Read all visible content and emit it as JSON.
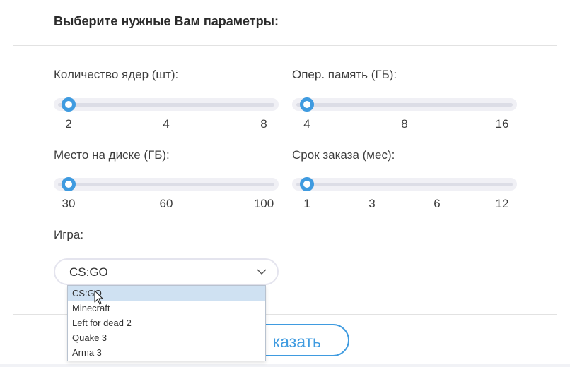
{
  "title": "Выберите нужные Вам параметры:",
  "params": {
    "cores": {
      "label": "Количество ядер (шт):",
      "ticks": [
        "2",
        "4",
        "8"
      ],
      "value": 2
    },
    "ram": {
      "label": "Опер. память (ГБ):",
      "ticks": [
        "4",
        "8",
        "16"
      ],
      "value": 4
    },
    "disk": {
      "label": "Место на диске (ГБ):",
      "ticks": [
        "30",
        "60",
        "100"
      ],
      "value": 30
    },
    "term": {
      "label": "Срок заказа (мес):",
      "ticks": [
        "1",
        "3",
        "6",
        "12"
      ],
      "value": 1
    }
  },
  "game": {
    "label": "Игра:",
    "selected": "CS:GO",
    "options": [
      "CS:GO",
      "Minecraft",
      "Left for dead 2",
      "Quake 3",
      "Arma 3"
    ]
  },
  "order_button": {
    "label": "казать"
  },
  "colors": {
    "accent": "#3f9be0",
    "track": "#dcdde6",
    "selected_option": "#cfe1f2"
  },
  "icons": {
    "select": "chevron-down-icon",
    "pointer": "mouse-cursor-icon"
  }
}
